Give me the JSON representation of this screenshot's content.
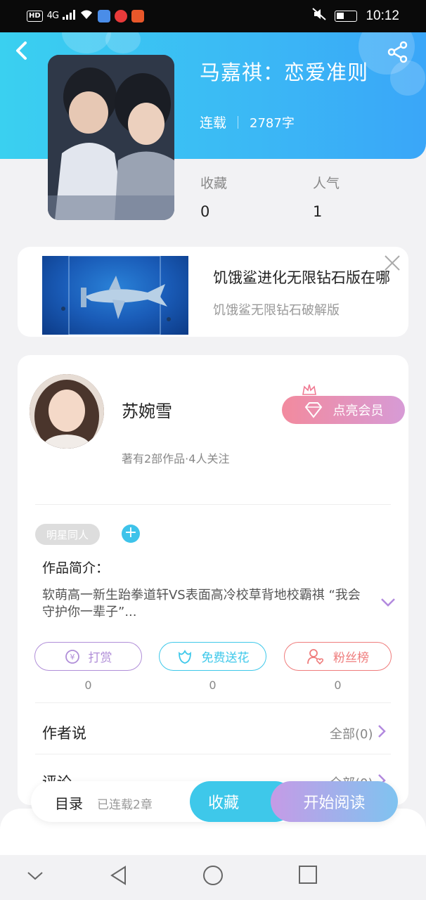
{
  "status_bar": {
    "network": "4G",
    "time": "10:12"
  },
  "header": {
    "title": "马嘉祺：恋爱准则",
    "status": "连载",
    "word_count": "2787字"
  },
  "stats": [
    {
      "label": "收藏",
      "value": "0"
    },
    {
      "label": "人气",
      "value": "1"
    }
  ],
  "ad": {
    "title": "饥饿鲨进化无限钻石版在哪",
    "subtitle": "饥饿鲨无限钻石破解版"
  },
  "author": {
    "name": "苏婉雪",
    "info": "著有2部作品·4人关注",
    "vip_label": "点亮会员"
  },
  "tag": "明星同人",
  "intro": {
    "heading": "作品简介：",
    "text": "软萌高一新生跆拳道轩VS表面高冷校草背地校霸祺 “我会守护你一辈子”..."
  },
  "actions": [
    {
      "label": "打赏",
      "count": "0",
      "color": "#b08ed8"
    },
    {
      "label": "免费送花",
      "count": "0",
      "color": "#3ec8ea"
    },
    {
      "label": "粉丝榜",
      "count": "0",
      "color": "#ef7c7c"
    }
  ],
  "rows": [
    {
      "label": "作者说",
      "right": "全部(0)"
    },
    {
      "label": "评论",
      "right": "全部(0)"
    }
  ],
  "bottom_bar": {
    "toc": "目录",
    "serial": "已连载2章",
    "favorite": "收藏",
    "read": "开始阅读"
  },
  "nav": [
    "chevron-down-icon",
    "back-triangle-icon",
    "home-circle-icon",
    "recent-square-icon"
  ]
}
